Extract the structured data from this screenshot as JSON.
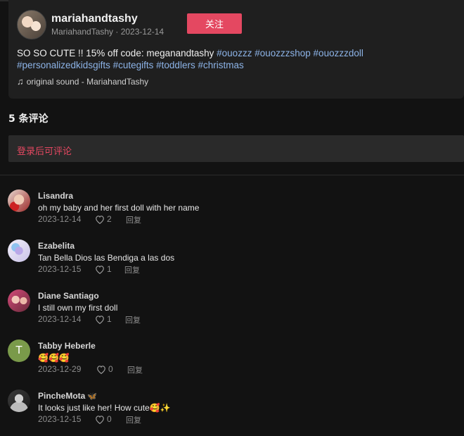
{
  "post": {
    "author_name": "mariahandtashy",
    "author_meta": "MariahandTashy · 2023-12-14",
    "follow_label": "关注",
    "caption_text": "SO SO CUTE !! 15% off code: meganandtashy ",
    "hashtags_line1": [
      "#ouozzz",
      "#ouozzzshop",
      "#ouozzzdoll"
    ],
    "hashtags_line2": [
      "#personalizedkidsgifts",
      "#cutegifts",
      "#toddlers",
      "#christmas"
    ],
    "sound_icon": "music-note-icon",
    "sound_text": "original sound - MariahandTashy"
  },
  "comments_header": "5 条评论",
  "login_prompt": "登录后可评论",
  "reply_label": "回复",
  "colors": {
    "accent": "#e44861",
    "hashtag": "#8db4e8",
    "background": "#121212"
  },
  "comments": [
    {
      "name": "Lisandra",
      "text": "oh my baby and her first doll with her name",
      "date": "2023-12-14",
      "likes": "2"
    },
    {
      "name": "Ezabelita",
      "text": "Tan Bella Dios las Bendiga a las dos",
      "date": "2023-12-15",
      "likes": "1"
    },
    {
      "name": "Diane Santiago",
      "text": "I still own my first doll",
      "date": "2023-12-14",
      "likes": "1"
    },
    {
      "name": "Tabby Heberle",
      "avatar_letter": "T",
      "text": "🥰🥰🥰",
      "date": "2023-12-29",
      "likes": "0"
    },
    {
      "name": "PincheMota",
      "badge": "🦋",
      "text": "It looks just like her! How cute🥰✨",
      "date": "2023-12-15",
      "likes": "0"
    }
  ]
}
